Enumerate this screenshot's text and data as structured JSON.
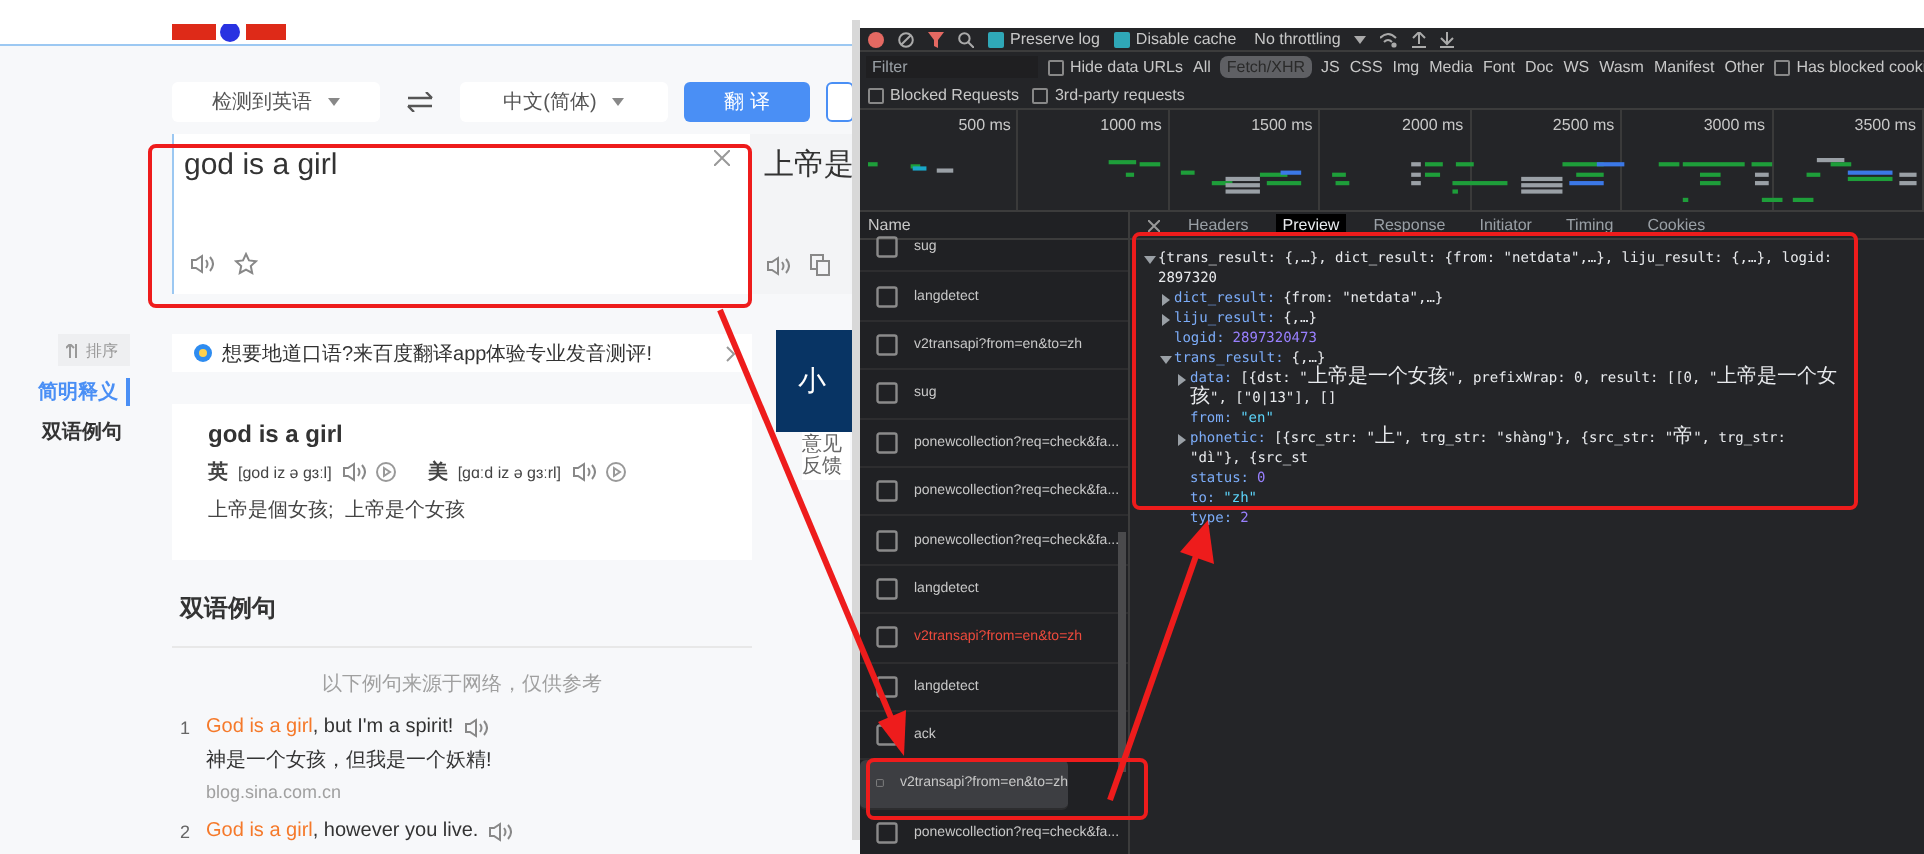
{
  "baidu_page": {
    "source_language": "检测到英语",
    "target_language": "中文(简体)",
    "translate_button": "翻 译",
    "input": {
      "value": "god is a girl"
    },
    "output": "上帝是",
    "sidebar": {
      "sort_button": "排序",
      "items": [
        {
          "label": "简明释义",
          "selected": true
        },
        {
          "label": "双语例句",
          "selected": false
        }
      ]
    },
    "banner": "想要地道口语?来百度翻译app体验专业发音测评!",
    "dictionary": {
      "headword": "god is a girl",
      "pronunciations": [
        {
          "label": "英",
          "phonetic": "[god iz ə gɜːl]"
        },
        {
          "label": "美",
          "phonetic": "[gɑːd iz ə gɜːrl]"
        }
      ],
      "meaning": "上帝是個女孩;  上帝是个女孩"
    },
    "examples_title": "双语例句",
    "examples_note": "以下例句来源于网络，仅供参考",
    "examples": [
      {
        "number": "1",
        "highlight": "God is a girl",
        "rest": ", but I'm a spirit!",
        "translation": "神是一个女孩，但我是一个妖精!",
        "source": "blog.sina.com.cn"
      },
      {
        "number": "2",
        "highlight": "God is a girl",
        "rest": ", however you live."
      }
    ],
    "ad": {
      "text": "小",
      "feedback": "意见反馈"
    }
  },
  "devtools": {
    "toolbar": {
      "checkboxes": [
        {
          "label": "Preserve log",
          "checked": true
        },
        {
          "label": "Disable cache",
          "checked": true
        }
      ],
      "throttling": "No throttling"
    },
    "filter": {
      "placeholder": "Filter",
      "hide_data_urls": {
        "label": "Hide data URLs",
        "checked": false
      },
      "types": [
        {
          "label": "All",
          "selected": false
        },
        {
          "label": "Fetch/XHR",
          "selected": true
        },
        {
          "label": "JS",
          "selected": false
        },
        {
          "label": "CSS",
          "selected": false
        },
        {
          "label": "Img",
          "selected": false
        },
        {
          "label": "Media",
          "selected": false
        },
        {
          "label": "Font",
          "selected": false
        },
        {
          "label": "Doc",
          "selected": false
        },
        {
          "label": "WS",
          "selected": false
        },
        {
          "label": "Wasm",
          "selected": false
        },
        {
          "label": "Manifest",
          "selected": false
        },
        {
          "label": "Other",
          "selected": false
        }
      ],
      "has_blocked_cookies": {
        "label": "Has blocked cooki",
        "checked": false
      },
      "more": [
        {
          "label": "Blocked Requests",
          "checked": false
        },
        {
          "label": "3rd-party requests",
          "checked": false
        }
      ]
    },
    "timeline_ticks": [
      "500 ms",
      "1000 ms",
      "1500 ms",
      "2000 ms",
      "2500 ms",
      "3000 ms",
      "3500 ms"
    ],
    "name_header": "Name",
    "requests": [
      {
        "name": "sug",
        "selected": false,
        "error": false
      },
      {
        "name": "langdetect",
        "selected": false,
        "error": false
      },
      {
        "name": "v2transapi?from=en&to=zh",
        "selected": false,
        "error": false
      },
      {
        "name": "sug",
        "selected": false,
        "error": false
      },
      {
        "name": "ponewcollection?req=check&fa...",
        "selected": false,
        "error": false
      },
      {
        "name": "ponewcollection?req=check&fa...",
        "selected": false,
        "error": false
      },
      {
        "name": "ponewcollection?req=check&fa...",
        "selected": false,
        "error": false
      },
      {
        "name": "langdetect",
        "selected": false,
        "error": false
      },
      {
        "name": "v2transapi?from=en&to=zh",
        "selected": false,
        "error": true
      },
      {
        "name": "langdetect",
        "selected": false,
        "error": false
      },
      {
        "name": "ack",
        "selected": false,
        "error": false
      },
      {
        "name": "v2transapi?from=en&to=zh",
        "selected": true,
        "error": false
      },
      {
        "name": "ponewcollection?req=check&fa...",
        "selected": false,
        "error": false
      }
    ],
    "detail_tabs": [
      {
        "label": "Headers",
        "selected": false
      },
      {
        "label": "Preview",
        "selected": true
      },
      {
        "label": "Response",
        "selected": false
      },
      {
        "label": "Initiator",
        "selected": false
      },
      {
        "label": "Timing",
        "selected": false
      },
      {
        "label": "Cookies",
        "selected": false
      }
    ],
    "preview": [
      {
        "value": "{trans_result: {,…}, dict_result: {from: \"netdata\",…}, liju_result: {,…}, logid: 2897320",
        "kind": "object",
        "expanded": true,
        "children": [
          {
            "key": "dict_result:",
            "value": "{from: \"netdata\",…}",
            "kind": "object",
            "expanded": false
          },
          {
            "key": "liju_result:",
            "value": "{,…}",
            "kind": "object",
            "expanded": false
          },
          {
            "key": "logid:",
            "value": "2897320473",
            "kind": "number"
          },
          {
            "key": "trans_result:",
            "value": "{,…}",
            "kind": "object",
            "expanded": true,
            "children": [
              {
                "key": "data:",
                "value": "[{dst: \"上帝是一个女孩\", prefixWrap: 0, result: [[0, \"上帝是一个女孩\", [\"0|13\"], []",
                "kind": "object",
                "expanded": false
              },
              {
                "key": "from:",
                "value": "\"en\"",
                "kind": "string"
              },
              {
                "key": "phonetic:",
                "value": "[{src_str: \"上\", trg_str: \"shàng\"}, {src_str: \"帝\", trg_str: \"dì\"}, {src_st",
                "kind": "object",
                "expanded": false
              },
              {
                "key": "status:",
                "value": "0",
                "kind": "number"
              },
              {
                "key": "to:",
                "value": "\"zh\"",
                "kind": "string"
              },
              {
                "key": "type:",
                "value": "2",
                "kind": "number"
              }
            ]
          }
        ]
      }
    ]
  }
}
